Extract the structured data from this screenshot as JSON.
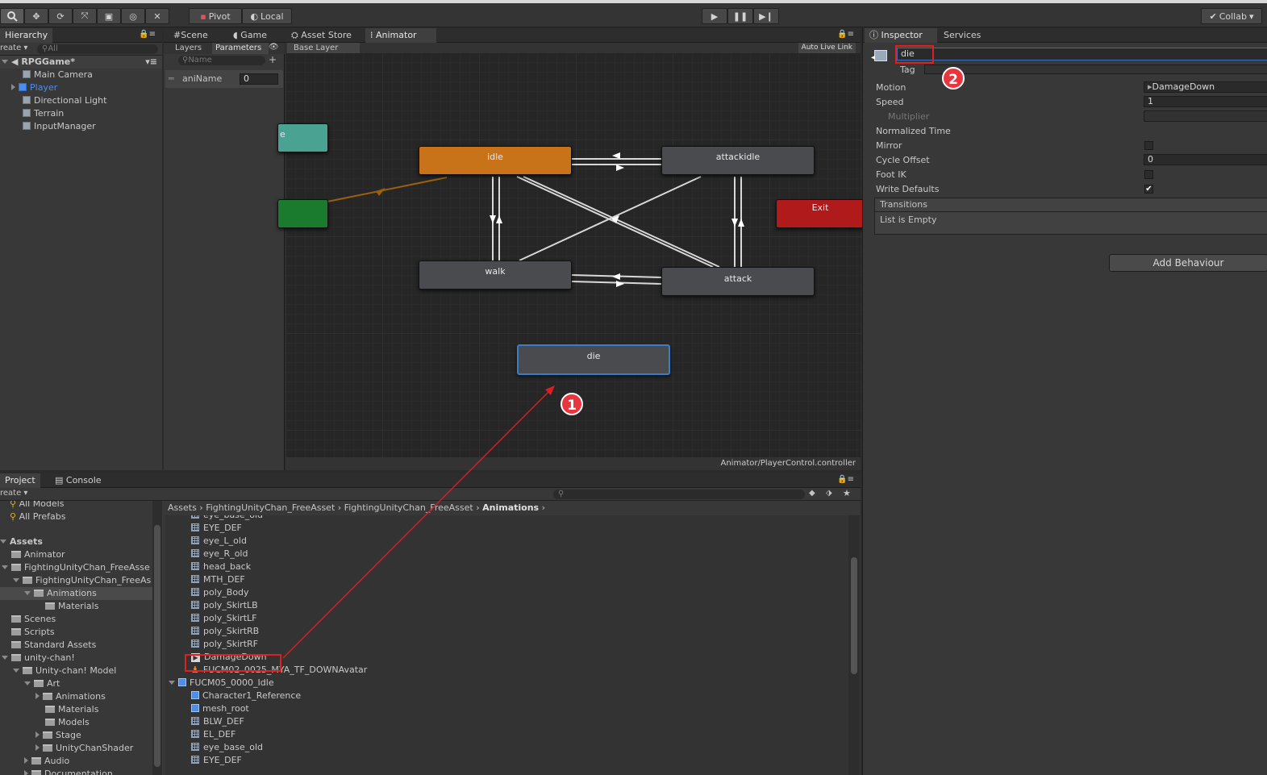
{
  "toolbar": {
    "pivot": "Pivot",
    "local": "Local",
    "collab": "Collab"
  },
  "hierarchy": {
    "tab": "Hierarchy",
    "create": "reate",
    "search_placeholder": "All",
    "scene": "RPGGame*",
    "items": [
      "Main Camera",
      "Player",
      "Directional Light",
      "Terrain",
      "InputManager"
    ]
  },
  "center_tabs": [
    "Scene",
    "Game",
    "Asset Store",
    "Animator"
  ],
  "animator": {
    "subtabs": [
      "Layers",
      "Parameters"
    ],
    "search_placeholder": "Name",
    "param_name": "aniName",
    "param_value": "0",
    "breadcrumb": "Base Layer",
    "auto_live_link": "Auto Live Link",
    "footer_path": "Animator/PlayerControl.controller",
    "states": {
      "idle": "idle",
      "attackidle": "attackidle",
      "walk": "walk",
      "attack": "attack",
      "die": "die",
      "exit": "Exit",
      "entry_partial": "e"
    }
  },
  "inspector": {
    "tabs": [
      "Inspector",
      "Services"
    ],
    "state_name": "die",
    "tag_label": "Tag",
    "fields": [
      {
        "label": "Motion",
        "value": "DamageDown"
      },
      {
        "label": "Speed",
        "value": "1"
      },
      {
        "label": "Multiplier",
        "value": ""
      },
      {
        "label": "Normalized Time",
        "value": ""
      },
      {
        "label": "Mirror",
        "value": ""
      },
      {
        "label": "Cycle Offset",
        "value": "0"
      },
      {
        "label": "Foot IK",
        "value": ""
      },
      {
        "label": "Write Defaults",
        "value": "✔"
      }
    ],
    "transitions_header": "Transitions",
    "transitions_empty": "List is Empty",
    "add_behaviour": "Add Behaviour"
  },
  "project": {
    "tabs": [
      "Project",
      "Console"
    ],
    "create": "reate",
    "favorites": [
      "All Models",
      "All Prefabs"
    ],
    "tree": [
      {
        "label": "Assets",
        "depth": 0,
        "bold": true
      },
      {
        "label": "Animator",
        "depth": 1
      },
      {
        "label": "FightingUnityChan_FreeAsse",
        "depth": 1
      },
      {
        "label": "FightingUnityChan_FreeAs",
        "depth": 2
      },
      {
        "label": "Animations",
        "depth": 3,
        "selected": true
      },
      {
        "label": "Materials",
        "depth": 4
      },
      {
        "label": "Scenes",
        "depth": 1
      },
      {
        "label": "Scripts",
        "depth": 1
      },
      {
        "label": "Standard Assets",
        "depth": 1
      },
      {
        "label": "unity-chan!",
        "depth": 1
      },
      {
        "label": "Unity-chan! Model",
        "depth": 2
      },
      {
        "label": "Art",
        "depth": 3
      },
      {
        "label": "Animations",
        "depth": 4
      },
      {
        "label": "Materials",
        "depth": 4
      },
      {
        "label": "Models",
        "depth": 4
      },
      {
        "label": "Stage",
        "depth": 4
      },
      {
        "label": "UnityChanShader",
        "depth": 4
      },
      {
        "label": "Audio",
        "depth": 3
      },
      {
        "label": "Documentation",
        "depth": 3
      }
    ],
    "breadcrumb": [
      "Assets",
      "FightingUnityChan_FreeAsset",
      "FightingUnityChan_FreeAsset",
      "Animations"
    ],
    "files": [
      {
        "label": "eye_base_old",
        "type": "mesh"
      },
      {
        "label": "EYE_DEF",
        "type": "mesh"
      },
      {
        "label": "eye_L_old",
        "type": "mesh"
      },
      {
        "label": "eye_R_old",
        "type": "mesh"
      },
      {
        "label": "head_back",
        "type": "mesh"
      },
      {
        "label": "MTH_DEF",
        "type": "mesh"
      },
      {
        "label": "poly_Body",
        "type": "mesh"
      },
      {
        "label": "poly_SkirtLB",
        "type": "mesh"
      },
      {
        "label": "poly_SkirtLF",
        "type": "mesh"
      },
      {
        "label": "poly_SkirtRB",
        "type": "mesh"
      },
      {
        "label": "poly_SkirtRF",
        "type": "mesh"
      },
      {
        "label": "DamageDown",
        "type": "anim"
      },
      {
        "label": "FUCM02_0025_MYA_TF_DOWNAvatar",
        "type": "avatar"
      },
      {
        "label": "FUCM05_0000_Idle",
        "type": "model"
      },
      {
        "label": "Character1_Reference",
        "type": "prefab"
      },
      {
        "label": "mesh_root",
        "type": "prefab"
      },
      {
        "label": "BLW_DEF",
        "type": "mesh"
      },
      {
        "label": "EL_DEF",
        "type": "mesh"
      },
      {
        "label": "eye_base_old",
        "type": "mesh"
      },
      {
        "label": "EYE_DEF",
        "type": "mesh"
      }
    ]
  },
  "annotations": {
    "badge1": "1",
    "badge2": "2",
    "accent": "#e8363e"
  }
}
